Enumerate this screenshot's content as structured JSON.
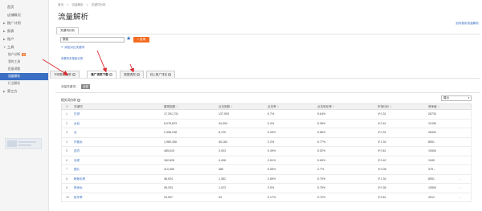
{
  "sidebar": {
    "items": [
      {
        "label": "首页",
        "arrow": ""
      },
      {
        "label": "店铺概况",
        "arrow": ""
      },
      {
        "label": "推广计划",
        "arrow": "▶"
      },
      {
        "label": "报表",
        "arrow": "▶"
      },
      {
        "label": "账户",
        "arrow": "▶"
      },
      {
        "label": "工具",
        "arrow": "▼"
      }
    ],
    "tools_sub": [
      {
        "label": "账户诊断",
        "badge": "新"
      },
      {
        "label": "我的工具",
        "badge": ""
      },
      {
        "label": "批量调整",
        "badge": ""
      },
      {
        "label": "流量解析",
        "badge": ""
      },
      {
        "label": "行业解析",
        "badge": ""
      }
    ],
    "third_party": {
      "label": "第三方",
      "arrow": "▶"
    }
  },
  "breadcrumb": [
    "首页",
    ">",
    "流量解析",
    ">",
    "关键词分析"
  ],
  "page_title": "流量解析",
  "help_link": "如何使用流量解析",
  "keyword_tab": "关键词分析",
  "keyword_input": {
    "value": "蛋糕"
  },
  "query_button": "查询",
  "add_compare": {
    "plus": "+",
    "label": "添加对比关键词"
  },
  "small_link": "查看历史搜索记录",
  "tabs": [
    {
      "label": "市场数据趋势",
      "q": "?"
    },
    {
      "label": "推广词表下载",
      "q": "?"
    },
    {
      "label": "数据透视",
      "q": "?"
    },
    {
      "label": "线上推广排名",
      "q": "?"
    }
  ],
  "filter": {
    "label": "流量关键词：",
    "button": "全部"
  },
  "section": {
    "title": "相关词分析",
    "q": "?"
  },
  "sort_select": {
    "value": "展示"
  },
  "table": {
    "headers": [
      "",
      "关键词",
      "展现指数",
      "点击指数",
      "点击率",
      "点击转化率",
      "市场均价",
      "竞争度",
      ""
    ],
    "rows": [
      {
        "idx": "1",
        "kw": "白领",
        "impr": "17,391,731",
        "clicks": "137,593",
        "ctr": "0.7%",
        "cvr": "0.64%",
        "price": "￥0.31",
        "comp": "28733",
        "act": ""
      },
      {
        "idx": "2",
        "kw": "女包",
        "impr": "8,078,823",
        "clicks": "34,494",
        "ctr": "0.4%",
        "cvr": "0.36%",
        "price": "￥0.41",
        "comp": "11336",
        "act": ""
      },
      {
        "idx": "3",
        "kw": "女",
        "impr": "2,398,238",
        "clicks": "8,720",
        "ctr": "0.33%",
        "cvr": "0.66%",
        "price": "￥0.31",
        "comp": "28332",
        "act": ""
      },
      {
        "idx": "4",
        "kw": "外套女",
        "impr": "1,980,306",
        "clicks": "45,183",
        "ctr": "2.2%",
        "cvr": "0.77%",
        "price": "￥1.34",
        "comp": "8551",
        "act": ""
      },
      {
        "idx": "5",
        "kw": "连衣",
        "impr": "485,615",
        "clicks": "3,003",
        "ctr": "0.49%",
        "cvr": "0.52%",
        "price": "￥0.61",
        "comp": "10554",
        "act": ""
      },
      {
        "idx": "6",
        "kw": "毛呢",
        "impr": "182,828",
        "clicks": "4,408",
        "ctr": "2.61%",
        "cvr": "0.69%",
        "price": "￥0.42",
        "comp": "1185",
        "act": ""
      },
      {
        "idx": "7",
        "kw": "图片",
        "impr": "113,496",
        "clicks": "486",
        "ctr": "0.35%",
        "cvr": "2.7%",
        "price": "￥0.08",
        "comp": "375 -",
        "act": ""
      },
      {
        "idx": "8",
        "kw": "韩版毛呢",
        "impr": "48,924",
        "clicks": "1,362",
        "ctr": "2.89%",
        "cvr": "0.79%",
        "price": "￥1.34",
        "comp": "8551",
        "act": "--"
      },
      {
        "idx": "9",
        "kw": "修身女",
        "impr": "38,203",
        "clicks": "1,023",
        "ctr": "2.5%",
        "cvr": "0.75%",
        "price": "￥0.36",
        "comp": "10554",
        "act": "--"
      },
      {
        "idx": "10",
        "kw": "秋冬季",
        "impr": "24,907",
        "clicks": "43",
        "ctr": "0.17%",
        "cvr": "0.72%",
        "price": "￥0.61",
        "comp": "4312",
        "act": "--"
      }
    ]
  }
}
